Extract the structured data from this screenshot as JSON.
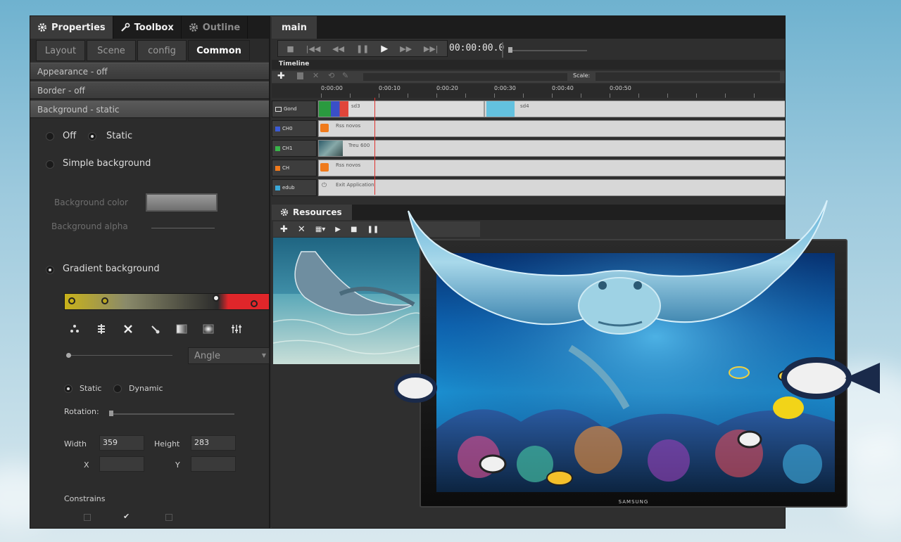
{
  "left_panel": {
    "tabs": [
      {
        "label": "Properties",
        "icon": "gear-icon"
      },
      {
        "label": "Toolbox",
        "icon": "wrench-icon"
      },
      {
        "label": "Outline",
        "icon": "gear-icon"
      }
    ],
    "sub_tabs": [
      "Layout",
      "Scene",
      "config",
      "Common"
    ],
    "sections": [
      "Appearance - off",
      "Border - off",
      "Background - static"
    ],
    "background": {
      "off_label": "Off",
      "static_label": "Static",
      "simple_label": "Simple background",
      "color_label": "Background color",
      "alpha_label": "Background alpha",
      "gradient_label": "Gradient background",
      "gradient_colors": [
        "#c9b21a",
        "#8a8a6a",
        "#2b2b2b",
        "#e0262a"
      ],
      "angle_label": "Angle",
      "mode_static": "Static",
      "mode_dynamic": "Dynamic",
      "rotation_label": "Rotation:"
    },
    "size": {
      "width_label": "Width",
      "width_value": "359",
      "height_label": "Height",
      "height_value": "283",
      "x_label": "X",
      "y_label": "Y"
    },
    "constrains_label": "Constrains"
  },
  "main": {
    "tab_label": "main",
    "timecode": "00:00:00.0",
    "timeline_label": "Timeline",
    "scale_label": "Scale:",
    "ruler": [
      "0:00:00",
      "0:00:10",
      "0:00:20",
      "0:00:30",
      "0:00:40",
      "0:00:50"
    ],
    "tracks": [
      {
        "label": "Gond",
        "color": "#d0d0d0",
        "clip": "sd3",
        "clip2": "sd4"
      },
      {
        "label": "CH0",
        "color": "#3b5bd6",
        "clip": "Rss novos"
      },
      {
        "label": "CH1",
        "color": "#39b54a",
        "clip": "Treu 600"
      },
      {
        "label": "CH",
        "color": "#f07a1c",
        "clip": "Rss novos"
      },
      {
        "label": "edub",
        "color": "#3aa8d8",
        "clip": "Exit Application"
      }
    ],
    "resources_label": "Resources"
  },
  "tv": {
    "brand": "SAMSUNG"
  }
}
